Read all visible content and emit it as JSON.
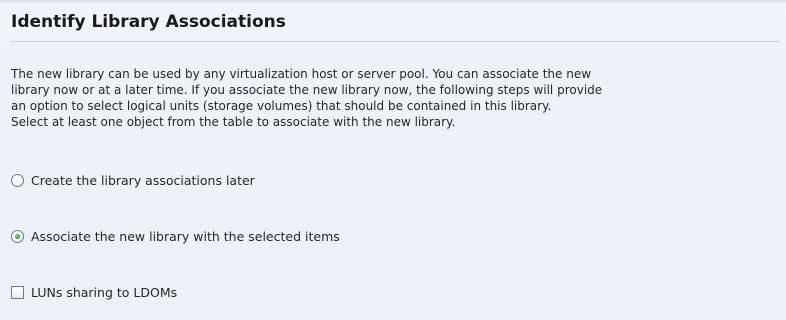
{
  "page": {
    "title": "Identify Library Associations",
    "description": [
      "The new library can be used by any virtualization host or server pool. You can associate the new",
      "library now or at a later time. If you associate the new library now, the following steps will provide",
      "an option to select logical units (storage volumes) that should be contained in this library.",
      "Select at least one object from the table to associate with the new library."
    ]
  },
  "options": {
    "create_later": {
      "label": "Create the library associations later",
      "checked": false
    },
    "associate_selected": {
      "label": "Associate the new library with the selected items",
      "checked": true
    }
  },
  "checkbox": {
    "luns_sharing": {
      "label": "LUNs sharing to LDOMs",
      "checked": false
    }
  },
  "colors": {
    "background": "#edf1f7",
    "radio_selected": "#2f9a2c",
    "text": "#262626"
  }
}
